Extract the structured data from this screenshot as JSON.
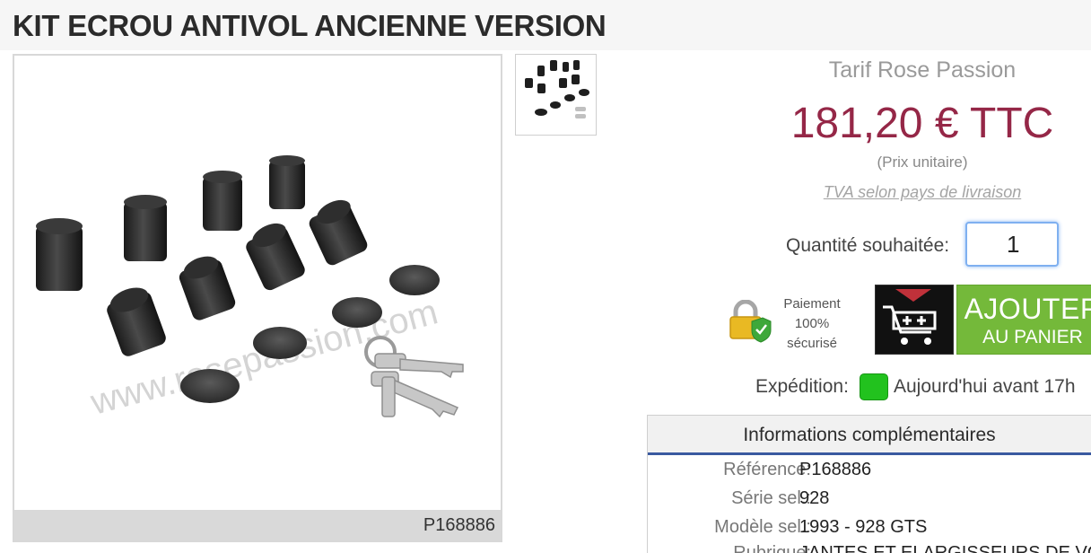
{
  "title": "KIT ECROU ANTIVOL ANCIENNE VERSION",
  "image": {
    "reference": "P168886",
    "watermark": "www.rosepassion.com",
    "thumb_icon": "product-thumbnail"
  },
  "pricing": {
    "label": "Tarif Rose Passion",
    "price": "181,20 € TTC",
    "unit": "(Prix unitaire)",
    "tva_link": "TVA selon pays de livraison",
    "price_color": "#952747"
  },
  "quantity": {
    "label": "Quantité souhaitée:",
    "value": "1"
  },
  "secure": {
    "line1": "Paiement",
    "line2": "100%",
    "line3": "sécurisé",
    "icon": "padlock-shield-icon"
  },
  "add_to_cart": {
    "line1": "AJOUTER",
    "line2": "AU PANIER",
    "icon": "cart-plus-icon",
    "color": "#74b93a"
  },
  "shipping": {
    "label": "Expédition:",
    "status": "Aujourd'hui avant 17h",
    "status_color": "#22c21e"
  },
  "info": {
    "heading": "Informations complémentaires",
    "rows": [
      {
        "key": "Référence:",
        "value": "P168886"
      },
      {
        "key": "Série sel.:",
        "value": "928"
      },
      {
        "key": "Modèle sel.:",
        "value": "1993 - 928 GTS"
      },
      {
        "key": "Rubrique:",
        "value": "JANTES ET ELARGISSEURS DE VOIE"
      }
    ]
  }
}
